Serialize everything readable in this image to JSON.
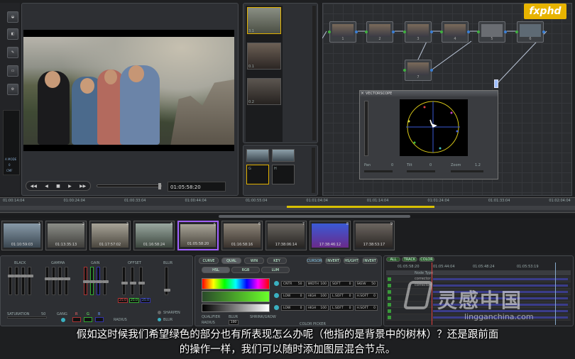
{
  "logo": {
    "text": "fxphd"
  },
  "viewer": {
    "timecode": "01:05:58:20"
  },
  "left_tools": {
    "labels": [
      "A MODE",
      "0",
      "CMF"
    ]
  },
  "gallery": {
    "stills": [
      {
        "label": "3.1"
      },
      {
        "label": "0.1"
      },
      {
        "label": "0.2"
      }
    ],
    "memory_labels": [
      "G",
      "H"
    ]
  },
  "node_graph": {
    "nodes": [
      {
        "label": "1"
      },
      {
        "label": "2"
      },
      {
        "label": "3"
      },
      {
        "label": "4"
      },
      {
        "label": "5"
      },
      {
        "label": "6"
      },
      {
        "label": "7"
      }
    ]
  },
  "vectorscope": {
    "title": "VECTORSCOPE",
    "controls": [
      {
        "label": "Pan",
        "value": "0"
      },
      {
        "label": "Tilt",
        "value": "0"
      },
      {
        "label": "Zoom",
        "value": "1.2"
      }
    ]
  },
  "timeline_ruler": {
    "ticks": [
      "01:00:14:04",
      "01:00:24:04",
      "01:00:33:04",
      "01:00:44:04",
      "01:00:55:04",
      "01:01:04:04",
      "01:01:14:04",
      "01:01:24:04",
      "01:01:33:04",
      "01:02:04:04"
    ]
  },
  "clips": [
    {
      "num": "1",
      "tc": "01:10:59:03"
    },
    {
      "num": "2",
      "tc": "01:13:35:13"
    },
    {
      "num": "3",
      "tc": "01:17:57:02"
    },
    {
      "num": "4",
      "tc": "01:16:58:24"
    },
    {
      "num": "5",
      "tc": "01:05:58:20"
    },
    {
      "num": "6",
      "tc": "01:16:58:16"
    },
    {
      "num": "7",
      "tc": "17:38:06:14"
    },
    {
      "num": "8",
      "tc": "17:38:46:12"
    },
    {
      "num": "9",
      "tc": "17:38:53:17"
    }
  ],
  "primaries": {
    "wheels": [
      {
        "label": "BLACK"
      },
      {
        "label": "GAMMA"
      },
      {
        "label": "GAIN"
      },
      {
        "label": "OFFSET"
      }
    ],
    "blur_label": "BLUR",
    "offset_values": [
      "25.0",
      "25.0",
      "25.0"
    ],
    "saturation": {
      "label": "SATURATION",
      "value": "50"
    },
    "gang": {
      "label": "GANG",
      "r": "R",
      "g": "G",
      "b": "B"
    },
    "radius_label": "RADIUS",
    "sharpen_label": "SHARPEN",
    "blur_radio_label": "BLUR"
  },
  "qualifier": {
    "tabs": [
      "CURVE",
      "QUAL",
      "WIN",
      "KEY"
    ],
    "subtabs": [
      "HSL",
      "RGB",
      "LUM"
    ],
    "side_buttons": [
      "CURSOR",
      "INVERT",
      "HS/GHT",
      "INVERT"
    ],
    "rows": [
      {
        "fields": [
          "CNTR",
          "WIDTH",
          "SOFT",
          "SKEW"
        ],
        "values": [
          "50",
          "100",
          "0",
          "50"
        ]
      },
      {
        "fields": [
          "LOW",
          "HIGH",
          "L.SOFT",
          "H.SOFT"
        ],
        "values": [
          "0",
          "100",
          "0",
          "0"
        ]
      },
      {
        "fields": [
          "LOW",
          "HIGH",
          "L.SOFT",
          "H.SOFT"
        ],
        "values": [
          "0",
          "100",
          "0",
          "0"
        ]
      }
    ],
    "bottom_labels": [
      "QUALIFIER",
      "BLUR",
      "SHRINK/GROW"
    ],
    "radius_label": "RADIUS",
    "radius_value": "100",
    "color_picker_label": "COLOR PICKER"
  },
  "keyframes": {
    "buttons": [
      "ALL",
      "TRACK",
      "COLOR"
    ],
    "timecodes": [
      "01:05:58:20",
      "01:05:44:04",
      "01:05:48:24",
      "01:05:53:19"
    ],
    "header": "Node Type",
    "rows": [
      "corrector",
      "corrector",
      "",
      "",
      "",
      "",
      ""
    ]
  },
  "subtitle": {
    "line1": "假如这时候我们希望绿色的部分也有所表现怎么办呢（他指的是背景中的树林）？还是跟前面",
    "line2": "的操作一样，我们可以随时添加图层混合节点。"
  },
  "watermark": {
    "cn": "灵感中国",
    "url": "lingganchina.com"
  },
  "colors": {
    "accent_yellow": "#e8b400",
    "selection_purple": "#a060ff",
    "node_out": "#3a7fd6",
    "node_in": "#3fb13f"
  }
}
